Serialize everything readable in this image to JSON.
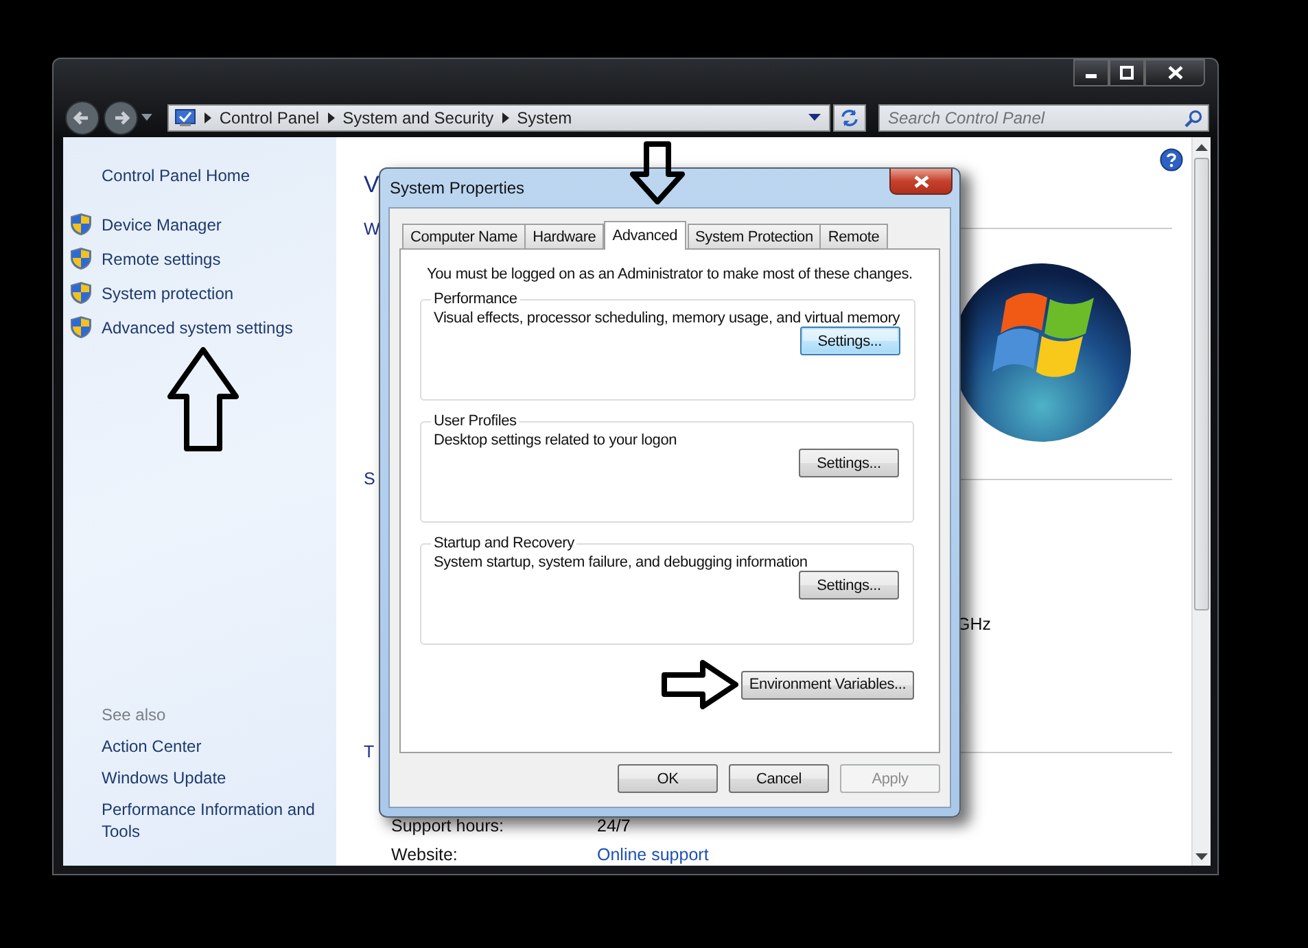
{
  "address_bar": {
    "breadcrumbs": [
      "Control Panel",
      "System and Security",
      "System"
    ]
  },
  "search": {
    "placeholder": "Search Control Panel"
  },
  "sidebar": {
    "home": "Control Panel Home",
    "tasks": [
      "Device Manager",
      "Remote settings",
      "System protection",
      "Advanced system settings"
    ],
    "see_also_title": "See also",
    "see_also": [
      "Action Center",
      "Windows Update",
      "Performance Information and Tools"
    ]
  },
  "main": {
    "heading": "V",
    "sections": [
      "W",
      "S",
      "T"
    ],
    "cpu_fragment": "GHz",
    "support": [
      {
        "label": "Support hours:",
        "value": "24/7",
        "kind": "text"
      },
      {
        "label": "Website:",
        "value": "Online support",
        "kind": "link"
      }
    ]
  },
  "dialog": {
    "title": "System Properties",
    "tabs": [
      {
        "label": "Computer Name",
        "selected": false
      },
      {
        "label": "Hardware",
        "selected": false
      },
      {
        "label": "Advanced",
        "selected": true
      },
      {
        "label": "System Protection",
        "selected": false
      },
      {
        "label": "Remote",
        "selected": false
      }
    ],
    "notice": "You must be logged on as an Administrator to make most of these changes.",
    "groups": [
      {
        "title": "Performance",
        "description": "Visual effects, processor scheduling, memory usage, and virtual memory",
        "button": "Settings...",
        "focused": true
      },
      {
        "title": "User Profiles",
        "description": "Desktop settings related to your logon",
        "button": "Settings...",
        "focused": false
      },
      {
        "title": "Startup and Recovery",
        "description": "System startup, system failure, and debugging information",
        "button": "Settings...",
        "focused": false
      }
    ],
    "env_button": "Environment Variables...",
    "buttons": [
      {
        "label": "OK",
        "disabled": false
      },
      {
        "label": "Cancel",
        "disabled": false
      },
      {
        "label": "Apply",
        "disabled": true
      }
    ]
  }
}
